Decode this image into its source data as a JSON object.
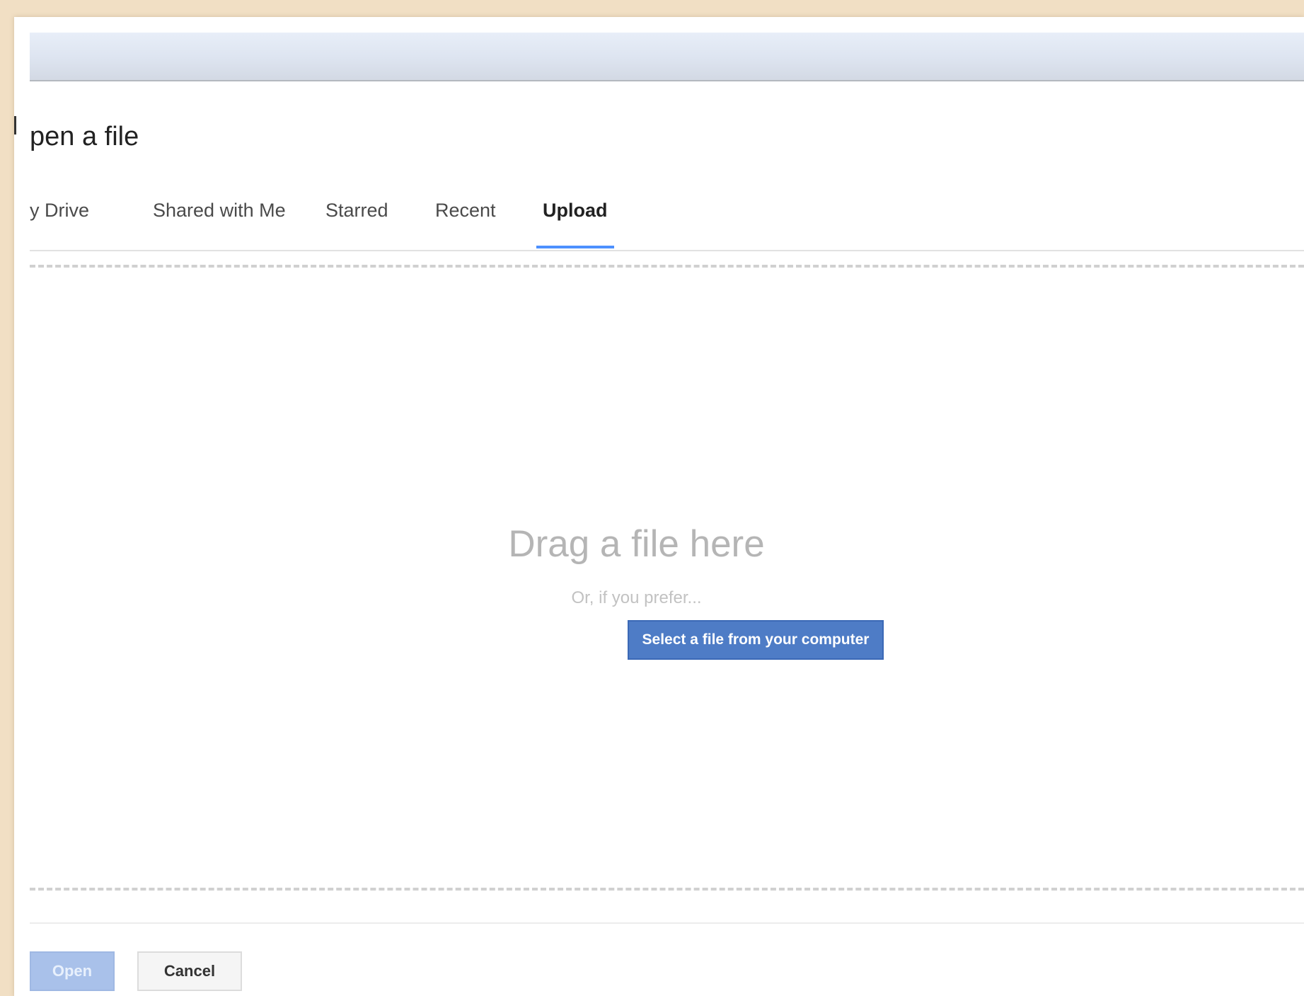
{
  "dialog": {
    "title": "pen a file"
  },
  "tabs": [
    {
      "label": "y Drive",
      "active": false
    },
    {
      "label": "Shared with Me",
      "active": false
    },
    {
      "label": "Starred",
      "active": false
    },
    {
      "label": "Recent",
      "active": false
    },
    {
      "label": "Upload",
      "active": true
    }
  ],
  "upload": {
    "drag_text": "Drag a file here",
    "or_text": "Or, if you prefer...",
    "select_button_label": "Select a file from your computer"
  },
  "footer": {
    "open_label": "Open",
    "cancel_label": "Cancel"
  },
  "colors": {
    "accent": "#4d90fe",
    "select_button": "#4e7cc6",
    "open_button_disabled": "#a9c1ea"
  }
}
